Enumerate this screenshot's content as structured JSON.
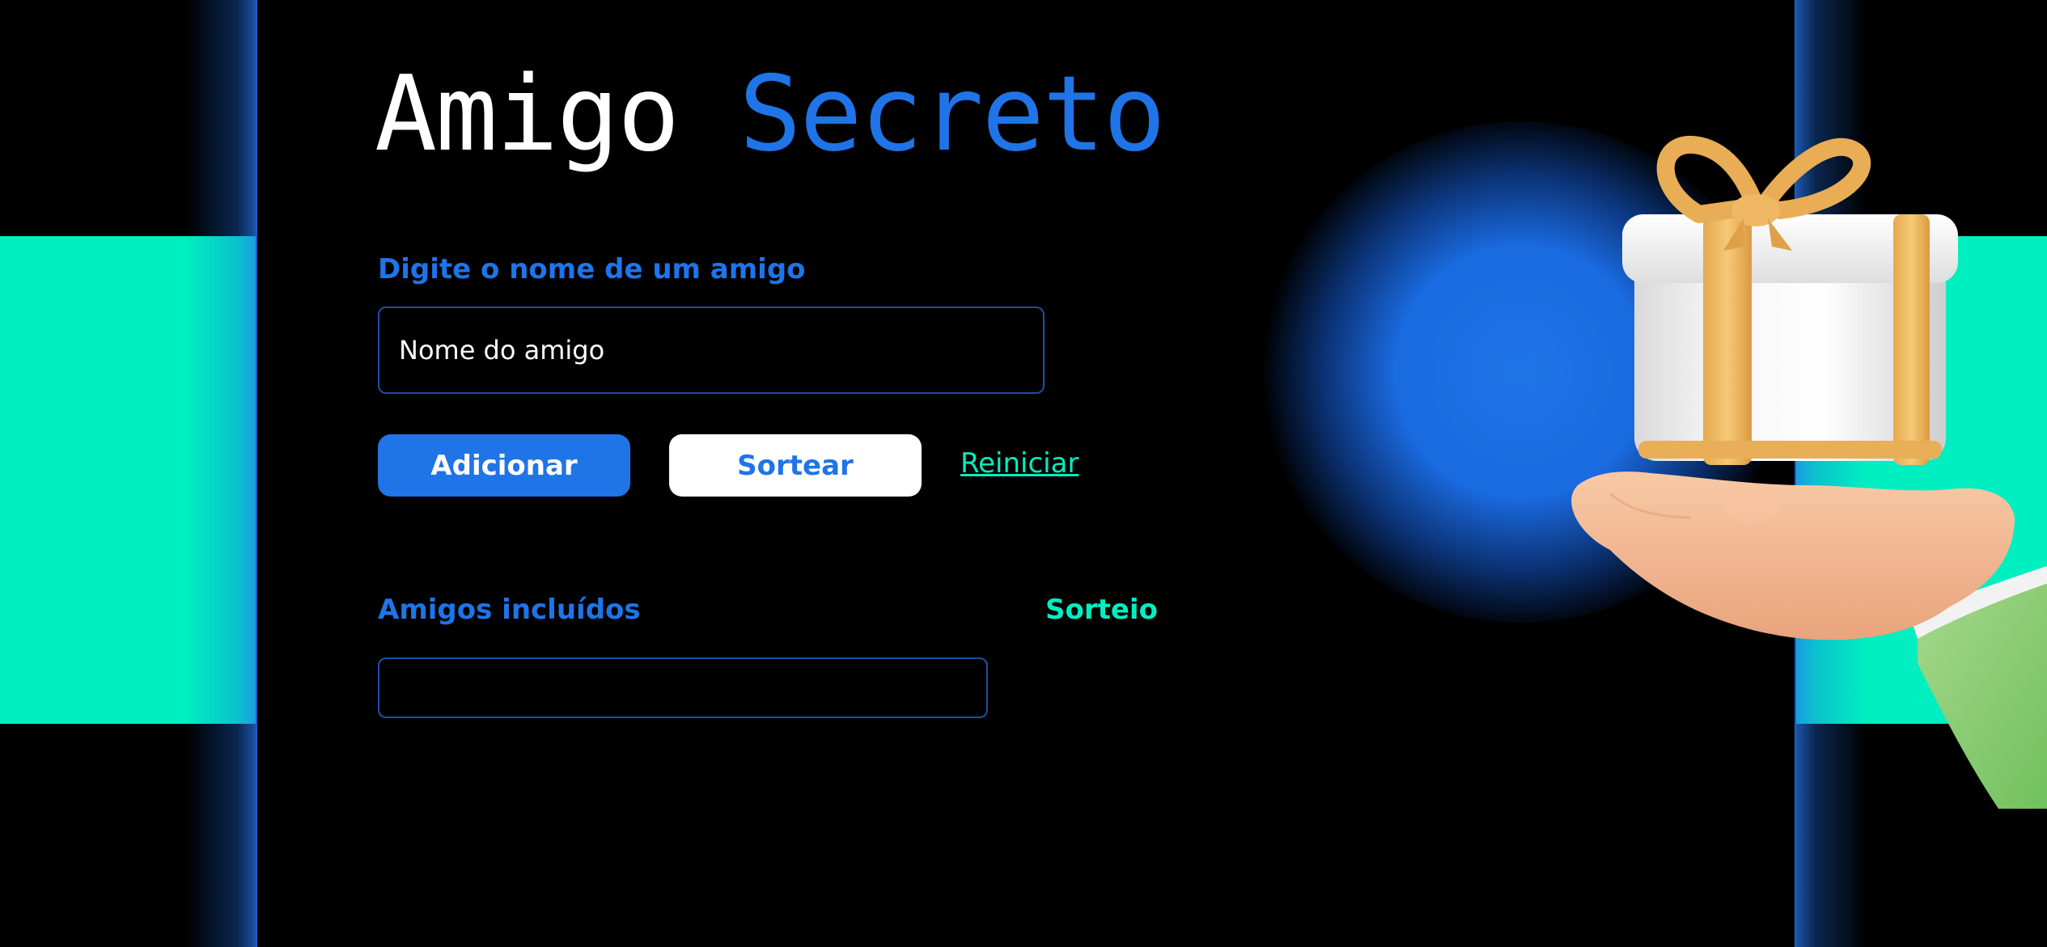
{
  "app": {
    "title_part1": "Amigo",
    "title_part2": "Secreto"
  },
  "form": {
    "input_label": "Digite o nome de um amigo",
    "input_placeholder": "Nome do amigo",
    "input_value": ""
  },
  "actions": {
    "add_label": "Adicionar",
    "draw_label": "Sortear",
    "reset_label": "Reiniciar"
  },
  "lists": {
    "friends_label": "Amigos incluídos",
    "result_label": "Sorteio",
    "friends": []
  },
  "illustration": {
    "icon": "gift-in-hand-icon"
  },
  "colors": {
    "accent_blue": "#1F74E8",
    "accent_green": "#00EFC0",
    "background": "#000000",
    "white": "#FFFFFF"
  }
}
